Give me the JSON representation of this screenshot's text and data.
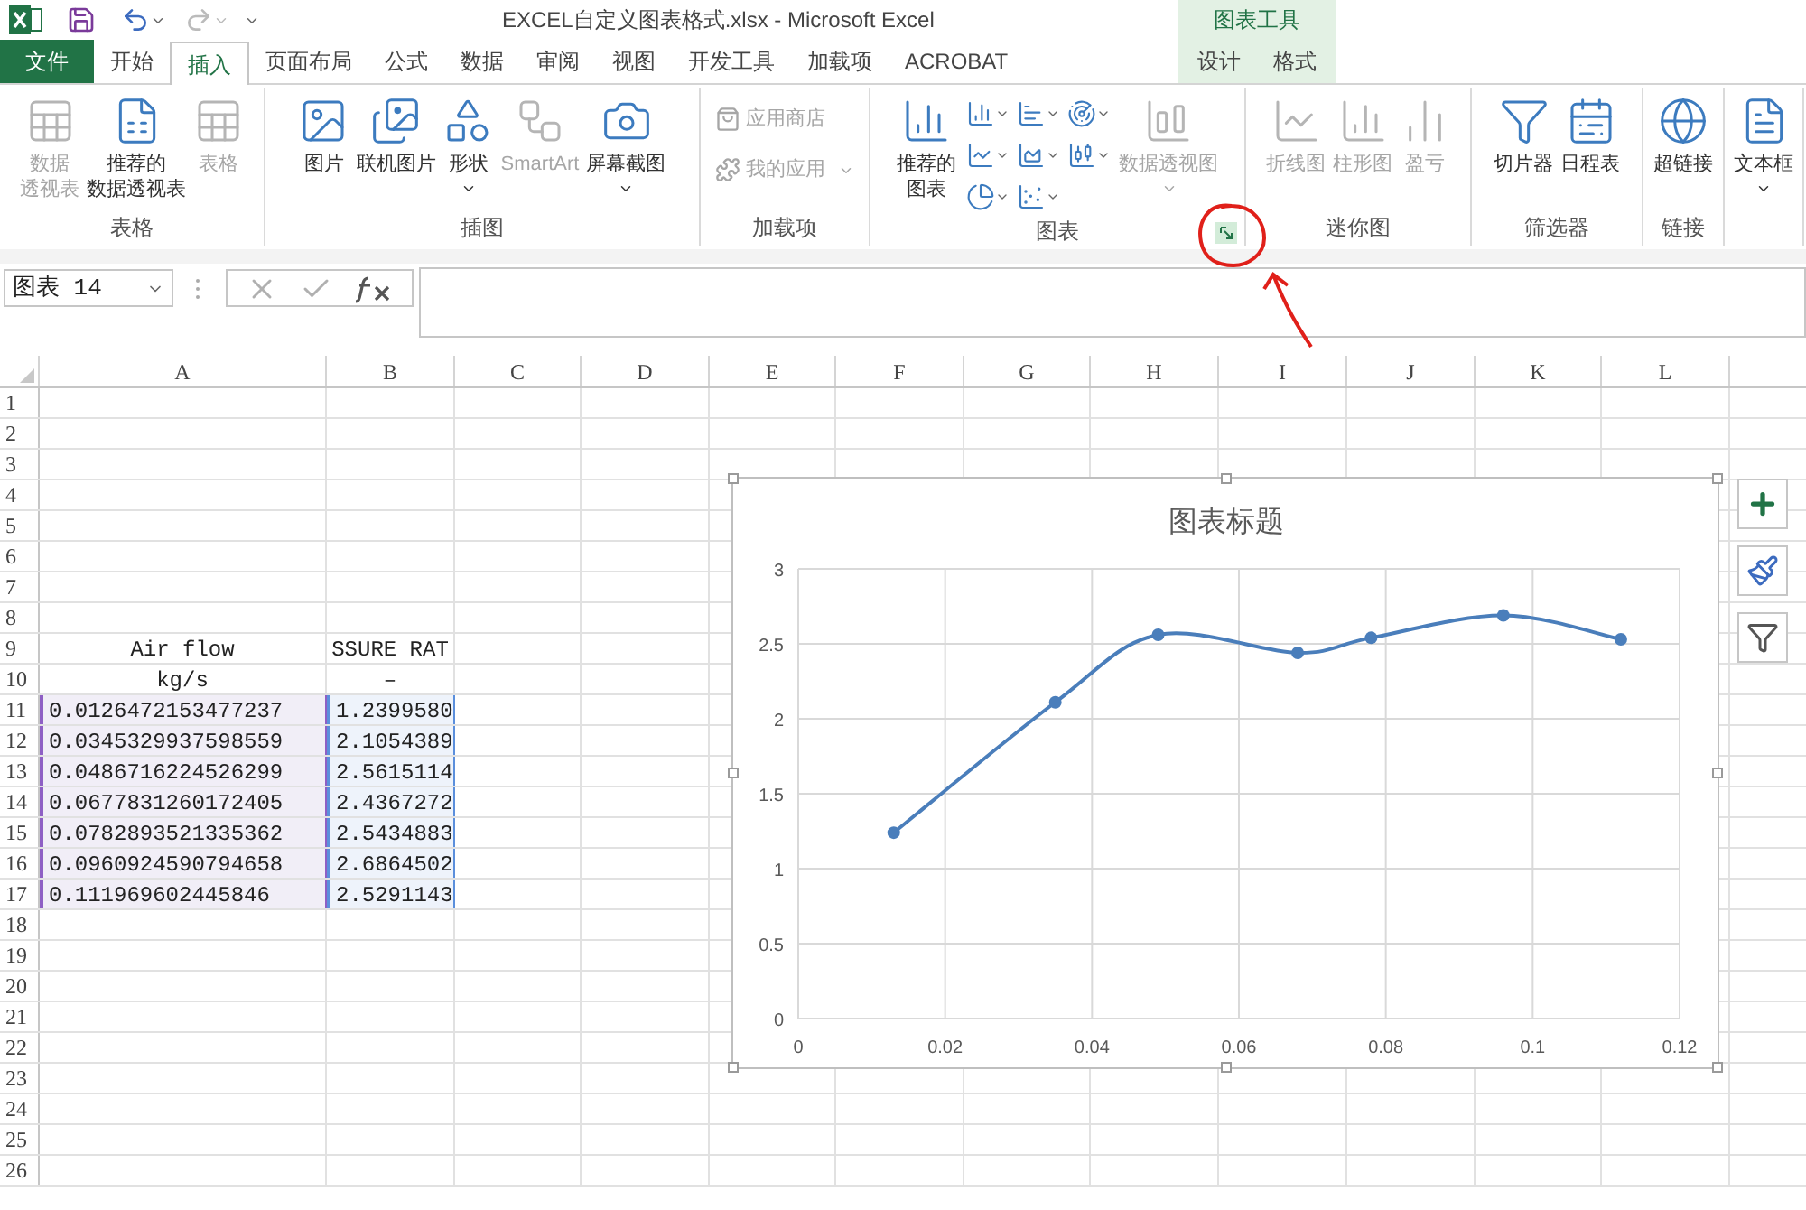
{
  "window": {
    "title": "EXCEL自定义图表格式.xlsx - Microsoft Excel"
  },
  "tabs": [
    {
      "label": "文件",
      "kind": "file",
      "selected": false
    },
    {
      "label": "开始",
      "kind": "normal",
      "selected": false
    },
    {
      "label": "插入",
      "kind": "normal",
      "selected": true
    },
    {
      "label": "页面布局",
      "kind": "normal",
      "selected": false
    },
    {
      "label": "公式",
      "kind": "normal",
      "selected": false
    },
    {
      "label": "数据",
      "kind": "normal",
      "selected": false
    },
    {
      "label": "审阅",
      "kind": "normal",
      "selected": false
    },
    {
      "label": "视图",
      "kind": "normal",
      "selected": false
    },
    {
      "label": "开发工具",
      "kind": "normal",
      "selected": false
    },
    {
      "label": "加载项",
      "kind": "normal",
      "selected": false
    },
    {
      "label": "ACROBAT",
      "kind": "normal",
      "selected": false
    },
    {
      "label": "设计",
      "kind": "contextual",
      "selected": false
    },
    {
      "label": "格式",
      "kind": "contextual",
      "selected": false
    }
  ],
  "contextual_header": "图表工具",
  "ribbon": {
    "groups": [
      {
        "label": "表格",
        "items": [
          {
            "kind": "large",
            "lines": [
              "数据",
              "透视表"
            ],
            "disabled": true
          },
          {
            "kind": "large",
            "lines": [
              "推荐的",
              "数据透视表"
            ],
            "disabled": false
          },
          {
            "kind": "large",
            "lines": [
              "表格"
            ],
            "disabled": true
          }
        ]
      },
      {
        "label": "插图",
        "items": [
          {
            "kind": "large",
            "lines": [
              "图片"
            ],
            "disabled": false
          },
          {
            "kind": "large",
            "lines": [
              "联机图片"
            ],
            "disabled": false
          },
          {
            "kind": "large",
            "lines": [
              "形状"
            ],
            "disabled": false,
            "caret": true
          },
          {
            "kind": "large",
            "lines": [
              "SmartArt"
            ],
            "disabled": true
          },
          {
            "kind": "large",
            "lines": [
              "屏幕截图"
            ],
            "disabled": false,
            "caret": true
          }
        ]
      },
      {
        "label": "加载项",
        "items": [
          {
            "kind": "small",
            "lines": [
              "应用商店"
            ],
            "disabled": true
          },
          {
            "kind": "small",
            "lines": [
              "我的应用"
            ],
            "disabled": true,
            "caret": true
          }
        ]
      },
      {
        "label": "图表",
        "launcher": true,
        "items": [
          {
            "kind": "large",
            "lines": [
              "推荐的",
              "图表"
            ],
            "disabled": false
          },
          {
            "kind": "chart_grid"
          },
          {
            "kind": "large",
            "lines": [
              "数据透视图"
            ],
            "disabled": true,
            "caret": true
          }
        ]
      },
      {
        "label": "迷你图",
        "items": [
          {
            "kind": "large",
            "lines": [
              "折线图"
            ],
            "disabled": true
          },
          {
            "kind": "large",
            "lines": [
              "柱形图"
            ],
            "disabled": true
          },
          {
            "kind": "large",
            "lines": [
              "盈亏"
            ],
            "disabled": true
          }
        ]
      },
      {
        "label": "筛选器",
        "items": [
          {
            "kind": "large",
            "lines": [
              "切片器"
            ],
            "disabled": false
          },
          {
            "kind": "large",
            "lines": [
              "日程表"
            ],
            "disabled": false
          }
        ]
      },
      {
        "label": "链接",
        "items": [
          {
            "kind": "large",
            "lines": [
              "超链接"
            ],
            "disabled": false
          }
        ]
      },
      {
        "items": [
          {
            "kind": "large",
            "lines": [
              "文本框"
            ],
            "disabled": false,
            "caret": true
          }
        ]
      }
    ]
  },
  "formula_bar": {
    "name_box": "图表 14"
  },
  "sheet": {
    "columns": [
      "A",
      "B",
      "C",
      "D",
      "E",
      "F",
      "G",
      "H",
      "I",
      "J",
      "K",
      "L"
    ],
    "rows": [
      {
        "number": "1"
      },
      {
        "number": "2"
      },
      {
        "number": "3"
      },
      {
        "number": "4"
      },
      {
        "number": "5"
      },
      {
        "number": "6"
      },
      {
        "number": "7"
      },
      {
        "number": "8"
      },
      {
        "number": "9",
        "kind": "header",
        "cells": [
          "Air flow",
          "SSURE RAT"
        ]
      },
      {
        "number": "10",
        "kind": "header",
        "cells": [
          "kg/s",
          "–"
        ]
      },
      {
        "number": "11",
        "kind": "data",
        "in_range": true,
        "cells": [
          "0.0126472153477237",
          "1.2399580"
        ]
      },
      {
        "number": "12",
        "kind": "data",
        "in_range": true,
        "cells": [
          "0.0345329937598559",
          "2.1054389"
        ]
      },
      {
        "number": "13",
        "kind": "data",
        "in_range": true,
        "cells": [
          "0.0486716224526299",
          "2.5615114"
        ]
      },
      {
        "number": "14",
        "kind": "data",
        "in_range": true,
        "cells": [
          "0.0677831260172405",
          "2.4367272"
        ]
      },
      {
        "number": "15",
        "kind": "data",
        "in_range": true,
        "cells": [
          "0.0782893521335362",
          "2.5434883"
        ]
      },
      {
        "number": "16",
        "kind": "data",
        "in_range": true,
        "cells": [
          "0.0960924590794658",
          "2.6864502"
        ]
      },
      {
        "number": "17",
        "kind": "data",
        "in_range": true,
        "cells": [
          "0.111969602445846",
          "2.5291143"
        ]
      },
      {
        "number": "18"
      },
      {
        "number": "19"
      },
      {
        "number": "20"
      },
      {
        "number": "21"
      },
      {
        "number": "22"
      },
      {
        "number": "23"
      },
      {
        "number": "24"
      },
      {
        "number": "25"
      },
      {
        "number": "26"
      }
    ]
  },
  "chart": {
    "chart_data": {
      "type": "line",
      "title": "图表标题",
      "grid": true,
      "x": [
        0.013,
        0.035,
        0.049,
        0.068,
        0.078,
        0.096,
        0.112
      ],
      "series": [
        {
          "color": "#4a7ebb",
          "marker": "circle",
          "values": [
            1.24,
            2.11,
            2.56,
            2.44,
            2.54,
            2.69,
            2.53
          ]
        }
      ],
      "xlim": [
        0,
        0.12
      ],
      "ylim": [
        0,
        3
      ],
      "xticks": [
        {
          "value": 0,
          "label": "0"
        },
        {
          "value": 0.02,
          "label": "0.02"
        },
        {
          "value": 0.04,
          "label": "0.04"
        },
        {
          "value": 0.06,
          "label": "0.06"
        },
        {
          "value": 0.08,
          "label": "0.08"
        },
        {
          "value": 0.1,
          "label": "0.1"
        },
        {
          "value": 0.12,
          "label": "0.12"
        }
      ],
      "yticks": [
        {
          "value": 0,
          "label": "0"
        },
        {
          "value": 0.5,
          "label": "0.5"
        },
        {
          "value": 1,
          "label": "1"
        },
        {
          "value": 1.5,
          "label": "1.5"
        },
        {
          "value": 2,
          "label": "2"
        },
        {
          "value": 2.5,
          "label": "2.5"
        },
        {
          "value": 3,
          "label": "3"
        }
      ]
    }
  }
}
